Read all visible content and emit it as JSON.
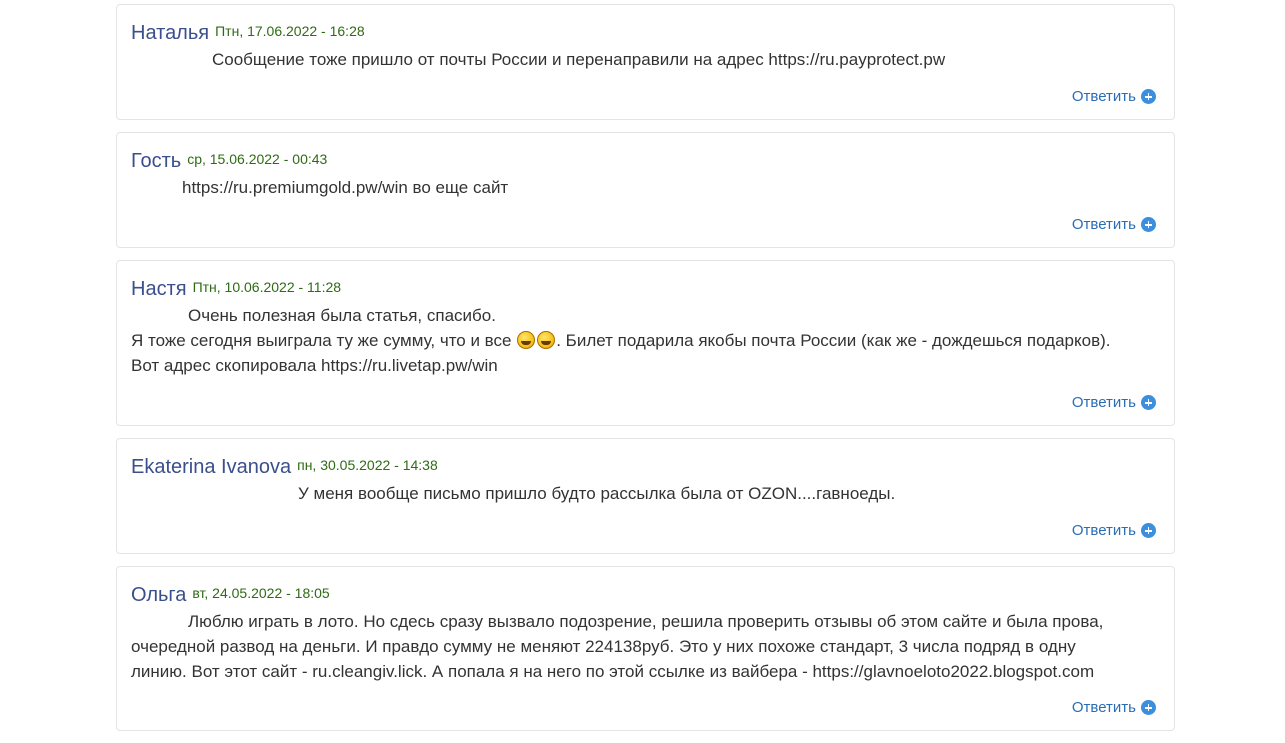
{
  "comments": [
    {
      "author": "Наталья",
      "date": "Птн, 17.06.2022 - 16:28",
      "lines": [
        "Сообщение тоже пришло от почты России и перенаправили на адрес https://ru.payprotect.pw"
      ],
      "reply_label": "Ответить"
    },
    {
      "author": "Гость",
      "date": "ср, 15.06.2022 - 00:43",
      "lines": [
        "https://ru.premiumgold.pw/win во еще сайт"
      ],
      "reply_label": "Ответить"
    },
    {
      "author": "Настя",
      "date": "Птн, 10.06.2022 - 11:28",
      "lines": [
        "Очень полезная была статья, спасибо.",
        "Я тоже сегодня выиграла ту же сумму, что и все",
        ". Билет подарила якобы почта России (как же - дождешься подарков).",
        "Вот адрес скопировала https://ru.livetap.pw/win"
      ],
      "emoji": "rolling-on-floor-laughing",
      "reply_label": "Ответить"
    },
    {
      "author": "Ekaterina Ivanova",
      "date": "пн, 30.05.2022 - 14:38",
      "lines": [
        "У меня вообще письмо пришло будто рассылка была от OZON....гавноеды."
      ],
      "reply_label": "Ответить"
    },
    {
      "author": "Ольга",
      "date": "вт, 24.05.2022 - 18:05",
      "lines": [
        "Люблю играть в лото. Но сдесь сразу вызвало подозрение, решила проверить отзывы об этом сайте и была прова,",
        "очередной развод на деньги. И правдо сумму не меняют 224138руб. Это у них похоже стандарт, 3 числа подряд в одну",
        "линию. Вот этот сайт - ru.cleangiv.lick. А попала я на него по этой ссылке из вайбера - https://glavnoeloto2022.blogspot.com"
      ],
      "reply_label": "Ответить"
    }
  ],
  "colors": {
    "author": "#3a4f8c",
    "date": "#2e6b14",
    "reply": "#2a6db5",
    "plus_icon": "#3b8fdc"
  }
}
